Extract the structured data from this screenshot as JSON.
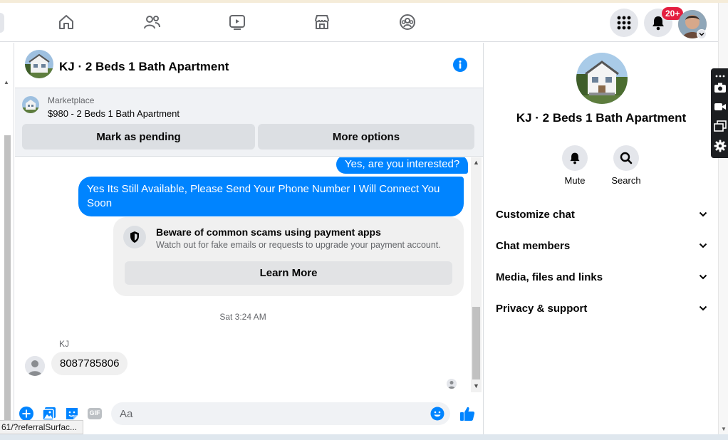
{
  "topnav": {
    "tabs": [
      "home",
      "friends",
      "watch",
      "marketplace",
      "groups"
    ],
    "notification_badge": "20+"
  },
  "chat": {
    "title": "KJ · 2 Beds 1 Bath Apartment"
  },
  "marketplace": {
    "label": "Marketplace",
    "listing": "$980 - 2 Beds 1 Bath Apartment",
    "pending_button": "Mark as pending",
    "options_button": "More options"
  },
  "messages": {
    "outgoing_1": "Yes, are you interested?",
    "outgoing_2": "Yes Its Still Available, Please Send Your Phone Number I Will Connect You Soon",
    "scam_title": "Beware of common scams using payment apps",
    "scam_subtitle": "Watch out for fake emails or requests to upgrade your payment account.",
    "learn_more": "Learn More",
    "timestamp": "Sat 3:24 AM",
    "sender": "KJ",
    "incoming_1": "8087785806"
  },
  "composer": {
    "placeholder": "Aa",
    "gif_label": "GIF"
  },
  "status_url": "61/?referralSurfac...",
  "right_panel": {
    "title": "KJ · 2 Beds 1 Bath Apartment",
    "mute_label": "Mute",
    "search_label": "Search",
    "sections": [
      "Customize chat",
      "Chat members",
      "Media, files and links",
      "Privacy & support"
    ]
  },
  "colors": {
    "accent": "#0084ff",
    "badge": "#e41e3f",
    "bubble_in": "#f0f0f0"
  }
}
